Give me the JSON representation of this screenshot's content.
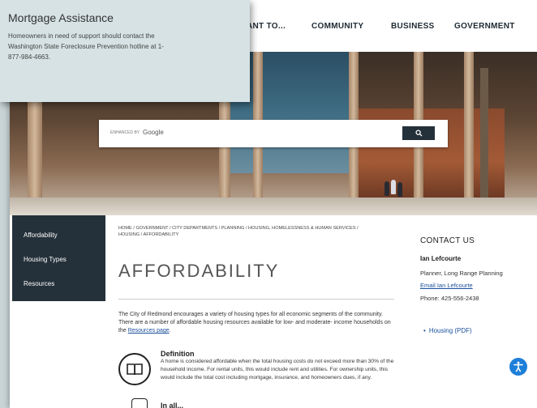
{
  "nav": {
    "items": [
      {
        "label": "ANT TO..."
      },
      {
        "label": "COMMUNITY"
      },
      {
        "label": "BUSINESS"
      },
      {
        "label": "GOVERNMENT"
      }
    ]
  },
  "search": {
    "enhanced_by": "ENHANCED BY",
    "google": "Google",
    "button_icon": "search-icon"
  },
  "sidebar": {
    "items": [
      {
        "label": "Affordability"
      },
      {
        "label": "Housing Types"
      },
      {
        "label": "Resources"
      }
    ]
  },
  "breadcrumb": "HOME / GOVERNMENT / CITY DEPARTMENTS / PLANNING / HOUSING, HOMELESSNESS & HUMAN SERVICES / HOUSING / AFFORDABILITY",
  "page_title": "AFFORDABILITY",
  "intro": {
    "text": "The City of Redmond encourages a variety of housing types for all economic segments of the community. There are a number of affordable housing resources available for low- and moderate- income households on the ",
    "link": "Resources page",
    "suffix": "."
  },
  "definition": {
    "title": "Definition",
    "text": "A home is considered affordable when the total housing costs do not exceed more than 30% of the household income. For rental units, this would include rent and utilities. For ownership units, this would include the total cost including mortgage, insurance, and homeowners dues, if any.",
    "icon": "book-icon"
  },
  "next_section": {
    "title": "In all..."
  },
  "contact": {
    "heading": "CONTACT US",
    "name": "Ian Lefcourte",
    "role": "Planner, Long Range Planning",
    "email": "Email Ian Lefcourte",
    "phone": "Phone: 425-556-2438"
  },
  "related": {
    "link": "Housing (PDF)"
  },
  "assist_card": {
    "title": "Mortgage Assistance",
    "text": "Homeowners in need of support should contact the Washington State Foreclosure Prevention hotline at 1-877-984-4663."
  },
  "colors": {
    "nav_dark": "#25313a",
    "link": "#1a4f9c",
    "card_bg": "#d6e2e4",
    "accessibility": "#1e7fd8"
  }
}
